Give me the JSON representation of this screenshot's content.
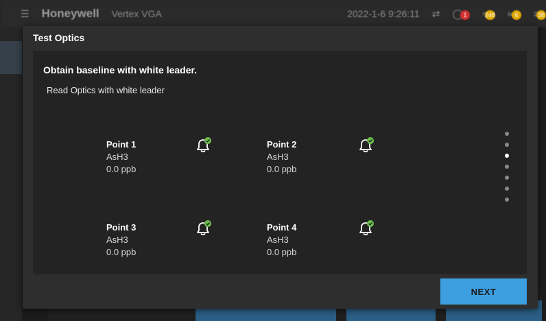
{
  "background": {
    "brand": "Honeywell",
    "product": "Vertex VGA",
    "datetime": "2022-1-6  9:26:11",
    "badges": [
      "1",
      "248",
      "6",
      "36"
    ]
  },
  "modal": {
    "title": "Test Optics",
    "heading": "Obtain baseline with white leader.",
    "instruction": "Read Optics with white leader",
    "points": [
      {
        "name": "Point 1",
        "gas": "AsH3",
        "reading": "0.0 ppb",
        "status_icon": "bell-ok-icon"
      },
      {
        "name": "Point 2",
        "gas": "AsH3",
        "reading": "0.0 ppb",
        "status_icon": "bell-ok-icon"
      },
      {
        "name": "Point 3",
        "gas": "AsH3",
        "reading": "0.0 ppb",
        "status_icon": "bell-ok-icon"
      },
      {
        "name": "Point 4",
        "gas": "AsH3",
        "reading": "0.0 ppb",
        "status_icon": "bell-ok-icon"
      }
    ],
    "pager": {
      "total": 7,
      "active_index": 2
    },
    "next_label": "NEXT"
  },
  "colors": {
    "accent": "#3d9ee0",
    "ok_green": "#6cc04a",
    "alarm_red": "#d32f2f",
    "badge_yellow": "#e0a800"
  }
}
